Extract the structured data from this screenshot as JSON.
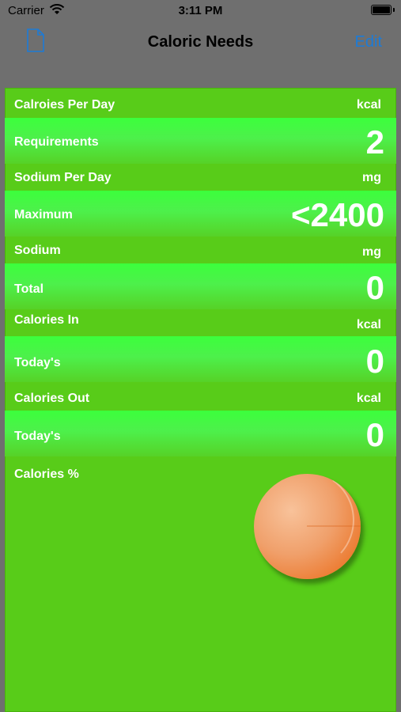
{
  "status": {
    "carrier": "Carrier",
    "time": "3:11 PM"
  },
  "nav": {
    "title": "Caloric Needs",
    "edit": "Edit"
  },
  "rows": {
    "calories_per_day": {
      "label": "Calroies Per Day",
      "unit": "kcal"
    },
    "requirements": {
      "label": "Requirements",
      "value": "2"
    },
    "sodium_per_day": {
      "label": "Sodium Per Day",
      "unit": "mg"
    },
    "maximum": {
      "label": "Maximum",
      "value": "<2400"
    },
    "sodium": {
      "label": "Sodium",
      "unit": "mg"
    },
    "total": {
      "label": "Total",
      "value": "0"
    },
    "calories_in": {
      "label": "Calories In",
      "unit": "kcal"
    },
    "todays_in": {
      "label": "Today's",
      "value": "0"
    },
    "calories_out": {
      "label": "Calories Out",
      "unit": "kcal"
    },
    "todays_out": {
      "label": "Today's",
      "value": "0"
    },
    "calories_pct": {
      "label": "Calories %"
    }
  },
  "colors": {
    "panel": "#58cc19",
    "highlight": "#3cff3c",
    "accent": "#1d7bd6",
    "ball": "#ec7a2f"
  },
  "icons": {
    "doc": "document-icon",
    "wifi": "wifi-icon",
    "battery": "battery-icon"
  }
}
